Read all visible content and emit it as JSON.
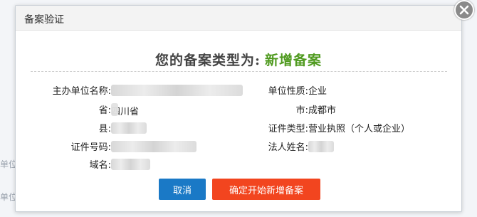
{
  "background": {
    "labels": [
      "单位",
      "单位"
    ]
  },
  "dialog": {
    "title": "备案验证",
    "headline_prefix": "您的备案类型为:",
    "headline_type": "新增备案",
    "fields_left": [
      {
        "label": "主办单位名称:",
        "value": ""
      },
      {
        "label": "省:",
        "value": "四川省"
      },
      {
        "label": "县:",
        "value": ""
      },
      {
        "label": "证件号码:",
        "value": ""
      },
      {
        "label": "域名:",
        "value": ""
      }
    ],
    "fields_right": [
      {
        "label": "单位性质:",
        "value": "企业"
      },
      {
        "label": "市:",
        "value": "成都市"
      },
      {
        "label": "证件类型:",
        "value": "营业执照（个人或企业）"
      },
      {
        "label": "法人姓名:",
        "value": ""
      }
    ],
    "buttons": {
      "cancel": "取消",
      "confirm": "确定开始新增备案"
    }
  },
  "colors": {
    "headline_type": "#4f9a1f",
    "cancel_button": "#1a79c6",
    "confirm_button": "#f2451f"
  },
  "icons": {
    "close": "close-icon"
  }
}
